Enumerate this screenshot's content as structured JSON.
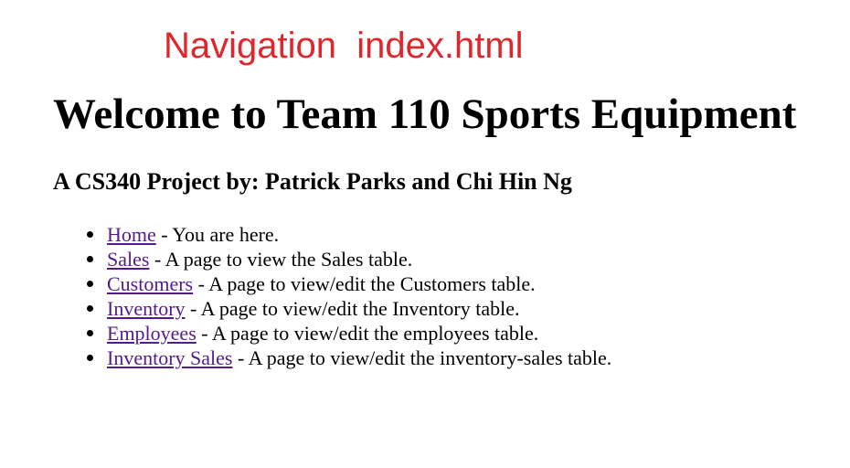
{
  "caption": {
    "text": "Navigation  index.html",
    "color": "#e0262d"
  },
  "page_title": "Welcome to Team 110 Sports Equipment",
  "subtitle": "A CS340 Project by: Patrick Parks and Chi Hin Ng",
  "link_color": "#551a8b",
  "nav": {
    "items": [
      {
        "link": "Home",
        "desc": " - You are here."
      },
      {
        "link": "Sales",
        "desc": " - A page to view the Sales table."
      },
      {
        "link": "Customers",
        "desc": " - A page to view/edit the Customers table."
      },
      {
        "link": "Inventory",
        "desc": " - A page to view/edit the Inventory table."
      },
      {
        "link": "Employees",
        "desc": " - A page to view/edit the employees table."
      },
      {
        "link": "Inventory Sales",
        "desc": " - A page to view/edit the inventory-sales table."
      }
    ]
  }
}
